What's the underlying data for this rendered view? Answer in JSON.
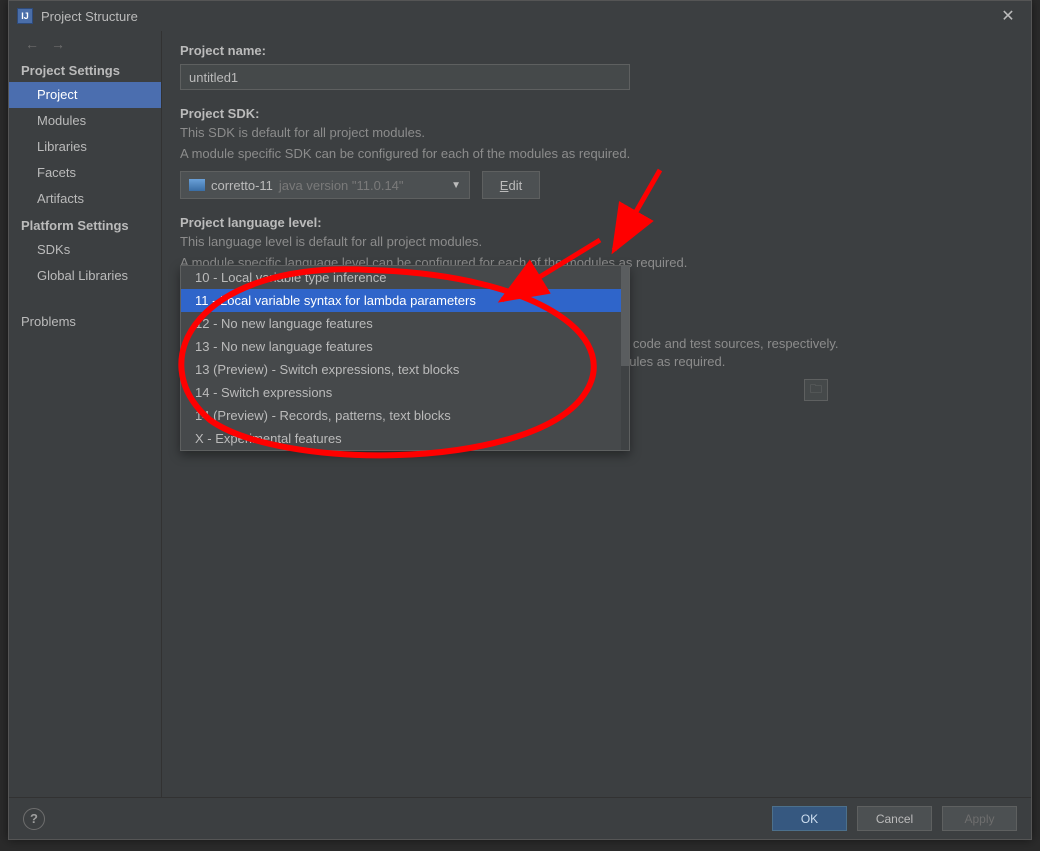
{
  "window": {
    "title": "Project Structure"
  },
  "sidebar": {
    "headers": {
      "project": "Project Settings",
      "platform": "Platform Settings"
    },
    "items": {
      "project": "Project",
      "modules": "Modules",
      "libraries": "Libraries",
      "facets": "Facets",
      "artifacts": "Artifacts",
      "sdks": "SDKs",
      "globallibs": "Global Libraries",
      "problems": "Problems"
    }
  },
  "labels": {
    "project_name": "Project name:",
    "project_sdk": "Project SDK:",
    "sdk_desc1": "This SDK is default for all project modules.",
    "sdk_desc2": "A module specific SDK can be configured for each of the modules as required.",
    "lang_level": "Project language level:",
    "lang_desc1": "This language level is default for all project modules.",
    "lang_desc2": "A module specific language level can be configured for each of the modules as required.",
    "edit": "Edit"
  },
  "fields": {
    "project_name_value": "untitled1",
    "sdk_name": "corretto-11",
    "sdk_version": "java version \"11.0.14\"",
    "lang_level_selected": "11 - Local variable syntax for lambda parameters"
  },
  "dropdown": {
    "options": [
      "10 - Local variable type inference",
      "11 - Local variable syntax for lambda parameters",
      "12 - No new language features",
      "13 - No new language features",
      "13 (Preview) - Switch expressions, text blocks",
      "14 - Switch expressions",
      "14 (Preview) - Records, patterns, text blocks",
      "X - Experimental features"
    ],
    "selected_index": 1
  },
  "peek": {
    "line1": "n code and test sources, respectively.",
    "line2": "dules as required."
  },
  "buttons": {
    "ok": "OK",
    "cancel": "Cancel",
    "apply": "Apply"
  }
}
